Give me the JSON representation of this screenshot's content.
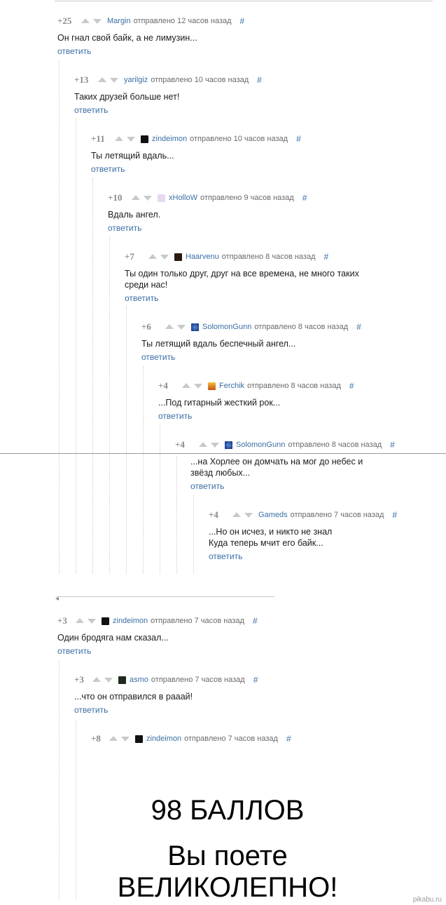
{
  "comments": [
    {
      "rating": "+25",
      "user": "Margin",
      "time": "отправлено 12 часов назад",
      "hash": "#",
      "text": "Он гнал свой байк, а не лимузин...",
      "reply": "ответить",
      "avatar": ""
    },
    {
      "rating": "+13",
      "user": "yarilgiz",
      "time": "отправлено 10 часов назад",
      "hash": "#",
      "text": "Таких друзей больше нет!",
      "reply": "ответить",
      "avatar": ""
    },
    {
      "rating": "+11",
      "user": "zindeimon",
      "time": "отправлено 10 часов назад",
      "hash": "#",
      "text": "Ты летящий вдаль...",
      "reply": "ответить",
      "avatar": "#111111"
    },
    {
      "rating": "+10",
      "user": "xHolloW",
      "time": "отправлено 9 часов назад",
      "hash": "#",
      "text": "Вдаль ангел.",
      "reply": "ответить",
      "avatar": "#e8d8f0"
    },
    {
      "rating": "+7",
      "user": "Haarvenu",
      "time": "отправлено 8 часов назад",
      "hash": "#",
      "text": "Ты один только друг, друг на все времена, не много таких среди нас!",
      "reply": "ответить",
      "avatar": "#2a1a12"
    },
    {
      "rating": "+6",
      "user": "SolomonGunn",
      "time": "отправлено 8 часов назад",
      "hash": "#",
      "text": "Ты летящий вдаль беспечный ангел...",
      "reply": "ответить",
      "avatar": "#1d4fa8"
    },
    {
      "rating": "+4",
      "user": "Ferchik",
      "time": "отправлено 8 часов назад",
      "hash": "#",
      "text": "...Под гитарный жесткий рок...",
      "reply": "ответить",
      "avatar": "#d8701a"
    },
    {
      "rating": "+4",
      "user": "SolomonGunn",
      "time": "отправлено 8 часов назад",
      "hash": "#",
      "text": "...на Хорлее он домчать на мог до небес и звёзд любых...",
      "reply": "ответить",
      "avatar": "#1d4fa8"
    },
    {
      "rating": "+4",
      "user": "Gameds",
      "time": "отправлено 7 часов назад",
      "hash": "#",
      "text": "...Но он исчез, и никто не знал\nКуда теперь мчит его байк...",
      "reply": "ответить",
      "avatar": ""
    },
    {
      "rating": "+3",
      "user": "zindeimon",
      "time": "отправлено 7 часов назад",
      "hash": "#",
      "text": "Один бродяга нам сказал...",
      "reply": "ответить",
      "avatar": "#111111"
    },
    {
      "rating": "+3",
      "user": "asmo",
      "time": "отправлено 7 часов назад",
      "hash": "#",
      "text": "...что он отправился в рааай!",
      "reply": "ответить",
      "avatar": "#1f2a1f"
    },
    {
      "rating": "+8",
      "user": "zindeimon",
      "time": "отправлено 7 часов назад",
      "hash": "#",
      "text": "",
      "reply": "",
      "avatar": "#111111"
    }
  ],
  "image_caption": {
    "line1": "98 БАЛЛОВ",
    "line2": "Вы поете",
    "line3": "ВЕЛИКОЛЕПНО!"
  },
  "watermark": "pikabu.ru"
}
